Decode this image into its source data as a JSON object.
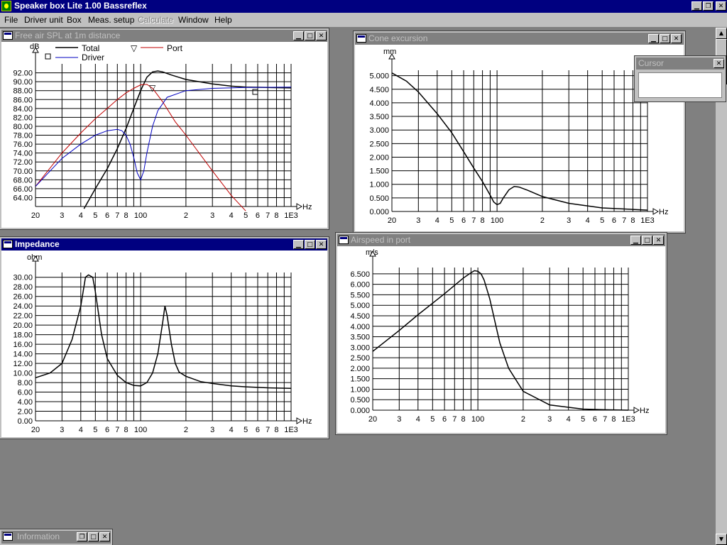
{
  "app": {
    "title": "Speaker box Lite 1.00 Bassreflex"
  },
  "menu": {
    "file": "File",
    "driver_unit": "Driver unit",
    "box": "Box",
    "meas_setup": "Meas. setup",
    "calculate": "Calculate",
    "window": "Window",
    "help": "Help"
  },
  "icons": {
    "minimize": "minimize-icon",
    "maximize": "maximize-icon",
    "restore": "restore-icon",
    "close": "close-icon",
    "scroll_up": "arrow-up-icon",
    "scroll_down": "arrow-down-icon"
  },
  "colors": {
    "titlebar_active": "#000080",
    "titlebar_inactive": "#808080",
    "total": "#000000",
    "port": "#c00000",
    "driver": "#0000c0"
  },
  "x_ticks": [
    "20",
    "3",
    "4",
    "5",
    "6",
    "7",
    "8",
    "100",
    "2",
    "3",
    "4",
    "5",
    "6",
    "7",
    "8",
    "1E3"
  ],
  "x_unit": "Hz",
  "windows": {
    "spl": {
      "title": "Free air SPL at 1m distance",
      "y_unit": "dB",
      "y_ticks": [
        "92.00",
        "90.00",
        "88.00",
        "86.00",
        "84.00",
        "82.00",
        "80.00",
        "78.00",
        "76.00",
        "74.00",
        "72.00",
        "70.00",
        "68.00",
        "66.00",
        "64.00"
      ],
      "legend": {
        "total": "Total",
        "port": "Port",
        "driver": "Driver"
      }
    },
    "cone": {
      "title": "Cone excursion",
      "y_unit": "mm",
      "y_ticks": [
        "5.000",
        "4.500",
        "4.000",
        "3.500",
        "3.000",
        "2.500",
        "2.000",
        "1.500",
        "1.000",
        "0.500",
        "0.000"
      ]
    },
    "impedance": {
      "title": "Impedance",
      "y_unit": "ohm",
      "y_ticks": [
        "30.00",
        "28.00",
        "26.00",
        "24.00",
        "22.00",
        "20.00",
        "18.00",
        "16.00",
        "14.00",
        "12.00",
        "10.00",
        "8.00",
        "6.00",
        "4.00",
        "2.00",
        "0.00"
      ]
    },
    "airspeed": {
      "title": "Airspeed in port",
      "y_unit": "m/s",
      "y_ticks": [
        "6.500",
        "6.000",
        "5.500",
        "5.000",
        "4.500",
        "4.000",
        "3.500",
        "3.000",
        "2.500",
        "2.000",
        "1.500",
        "1.000",
        "0.500",
        "0.000"
      ]
    },
    "cursor": {
      "title": "Cursor"
    },
    "information": {
      "title": "Information"
    }
  },
  "chart_data": [
    {
      "type": "line",
      "title": "Free air SPL at 1m distance",
      "xlabel": "Hz",
      "ylabel": "dB",
      "xscale": "log",
      "xlim": [
        20,
        1000
      ],
      "ylim": [
        62,
        94
      ],
      "grid": true,
      "legend": "top",
      "series": [
        {
          "name": "Total",
          "x": [
            42,
            50,
            60,
            70,
            80,
            90,
            100,
            110,
            120,
            130,
            140,
            160,
            200,
            300,
            400,
            500,
            700,
            1000
          ],
          "y": [
            61.5,
            66,
            70.5,
            75,
            79.5,
            84,
            88,
            91,
            92.2,
            92.4,
            92.2,
            91.5,
            90.5,
            89.5,
            89,
            88.8,
            88.7,
            88.6
          ]
        },
        {
          "name": "Port",
          "x": [
            20,
            30,
            40,
            50,
            60,
            70,
            80,
            90,
            100,
            110,
            120,
            140,
            170,
            200,
            300,
            400,
            500
          ],
          "y": [
            66.5,
            74,
            78.5,
            81.7,
            84,
            86,
            87.5,
            88.5,
            89.3,
            89.4,
            88.5,
            85.5,
            81,
            78,
            70,
            64.5,
            61
          ]
        },
        {
          "name": "Driver",
          "x": [
            20,
            30,
            40,
            50,
            60,
            70,
            75,
            80,
            85,
            90,
            95,
            100,
            105,
            110,
            120,
            130,
            150,
            200,
            300,
            500,
            1000
          ],
          "y": [
            66.5,
            72.8,
            76,
            78,
            79,
            79.3,
            79,
            78,
            76,
            73,
            69.5,
            68,
            70,
            74,
            80,
            83.5,
            86.5,
            88,
            88.5,
            88.7,
            88.8
          ]
        }
      ]
    },
    {
      "type": "line",
      "title": "Cone excursion",
      "xlabel": "Hz",
      "ylabel": "mm",
      "xscale": "log",
      "xlim": [
        20,
        1000
      ],
      "ylim": [
        0,
        5.2
      ],
      "grid": true,
      "series": [
        {
          "x": [
            20,
            25,
            30,
            40,
            50,
            60,
            70,
            80,
            90,
            95,
            100,
            105,
            110,
            120,
            130,
            140,
            160,
            200,
            300,
            500,
            1000
          ],
          "y": [
            5.1,
            4.8,
            4.4,
            3.6,
            2.9,
            2.2,
            1.6,
            1.1,
            0.6,
            0.35,
            0.25,
            0.3,
            0.5,
            0.8,
            0.92,
            0.9,
            0.78,
            0.55,
            0.3,
            0.13,
            0.05
          ]
        }
      ]
    },
    {
      "type": "line",
      "title": "Impedance",
      "xlabel": "Hz",
      "ylabel": "ohm",
      "xscale": "log",
      "xlim": [
        20,
        1000
      ],
      "ylim": [
        0,
        31
      ],
      "grid": true,
      "series": [
        {
          "x": [
            20,
            25,
            30,
            35,
            40,
            43,
            45,
            48,
            50,
            55,
            60,
            70,
            80,
            90,
            100,
            110,
            120,
            130,
            140,
            145,
            150,
            160,
            170,
            180,
            200,
            250,
            300,
            400,
            500,
            700,
            1000
          ],
          "y": [
            9,
            10,
            12,
            17,
            24,
            30,
            30.5,
            30,
            27,
            18,
            13,
            9.5,
            8,
            7.4,
            7.3,
            8,
            10,
            14,
            20.5,
            24,
            22,
            16,
            12,
            10.2,
            9.3,
            8.2,
            7.8,
            7.3,
            7.1,
            6.9,
            6.8
          ]
        }
      ]
    },
    {
      "type": "line",
      "title": "Airspeed in port",
      "xlabel": "Hz",
      "ylabel": "m/s",
      "xscale": "log",
      "xlim": [
        20,
        1000
      ],
      "ylim": [
        0,
        6.8
      ],
      "grid": true,
      "series": [
        {
          "x": [
            20,
            30,
            40,
            50,
            60,
            70,
            80,
            90,
            95,
            100,
            105,
            110,
            120,
            130,
            140,
            160,
            200,
            300,
            500,
            700,
            1000
          ],
          "y": [
            2.8,
            3.8,
            4.55,
            5.1,
            5.55,
            5.95,
            6.3,
            6.55,
            6.65,
            6.62,
            6.5,
            6.2,
            5.3,
            4.2,
            3.2,
            2,
            0.9,
            0.25,
            0.05,
            0.02,
            0.0
          ]
        }
      ]
    }
  ]
}
